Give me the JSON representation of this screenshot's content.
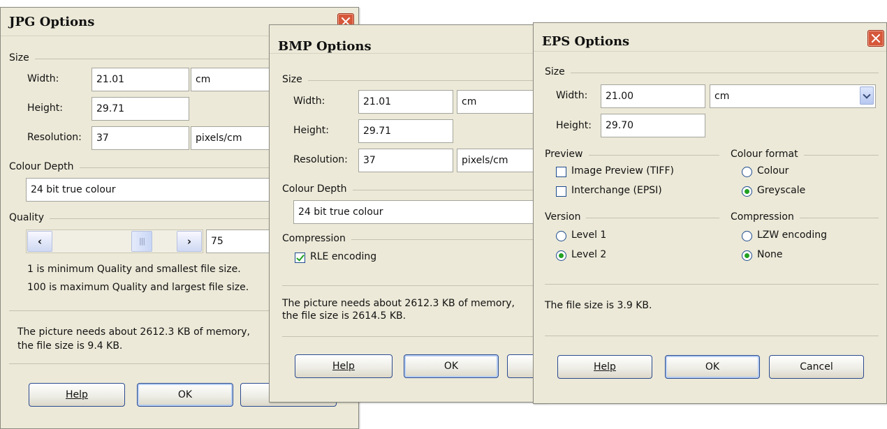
{
  "jpg": {
    "title": "JPG Options",
    "size_group": "Size",
    "width_label": "Width:",
    "width_value": "21.01",
    "width_unit": "cm",
    "height_label": "Height:",
    "height_value": "29.71",
    "resolution_label": "Resolution:",
    "resolution_value": "37",
    "resolution_unit": "pixels/cm",
    "colour_depth_group": "Colour Depth",
    "colour_depth_value": "24 bit true colour",
    "quality_group": "Quality",
    "quality_value": "75",
    "quality_min_note": "1 is minimum Quality and smallest file size.",
    "quality_max_note": "100 is maximum Quality and largest file size.",
    "memory_line1": "The picture needs about 2612.3 KB of memory,",
    "memory_line2": " the file size is 9.4 KB.",
    "help": "Help",
    "ok": "OK"
  },
  "bmp": {
    "title": "BMP Options",
    "size_group": "Size",
    "width_label": "Width:",
    "width_value": "21.01",
    "width_unit": "cm",
    "height_label": "Height:",
    "height_value": "29.71",
    "resolution_label": "Resolution:",
    "resolution_value": "37",
    "resolution_unit": "pixels/cm",
    "colour_depth_group": "Colour Depth",
    "colour_depth_value": "24 bit true colour",
    "compression_group": "Compression",
    "rle_label": "RLE encoding",
    "rle_checked": true,
    "memory_line1": "The picture needs about 2612.3 KB of memory,",
    "memory_line2": " the file size is 2614.5 KB.",
    "help": "Help",
    "ok": "OK"
  },
  "eps": {
    "title": "EPS Options",
    "size_group": "Size",
    "width_label": "Width:",
    "width_value": "21.00",
    "width_unit": "cm",
    "height_label": "Height:",
    "height_value": "29.70",
    "preview_group": "Preview",
    "image_preview": "Image Preview (TIFF)",
    "interchange": "Interchange (EPSI)",
    "colour_format_group": "Colour format",
    "colour": "Colour",
    "greyscale": "Greyscale",
    "version_group": "Version",
    "level1": "Level 1",
    "level2": "Level 2",
    "compression_group": "Compression",
    "lzw": "LZW encoding",
    "none": "None",
    "file_size_note": "The file size is 3.9 KB.",
    "help": "Help",
    "ok": "OK",
    "cancel": "Cancel"
  }
}
